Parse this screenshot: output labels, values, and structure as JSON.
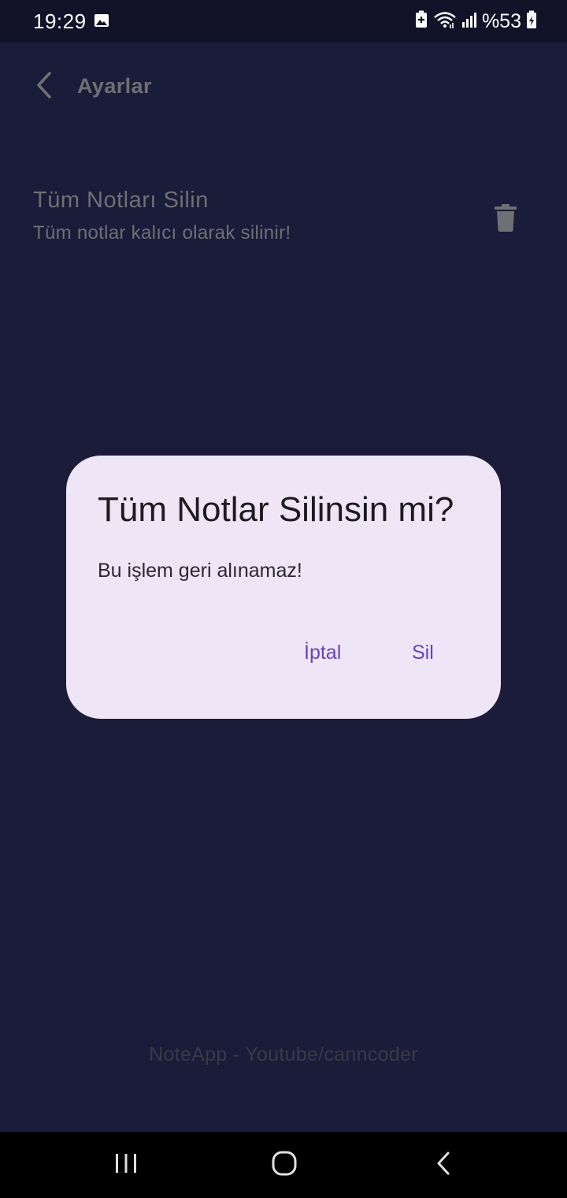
{
  "status_bar": {
    "time": "19:29",
    "battery_text": "%53",
    "icons": [
      "image-icon",
      "battery-saver-icon",
      "wifi-icon",
      "signal-icon",
      "battery-icon"
    ]
  },
  "header": {
    "title": "Ayarlar",
    "back_icon": "chevron-left-icon"
  },
  "settings": {
    "delete_all": {
      "title": "Tüm Notları Silin",
      "subtitle": "Tüm notlar kalıcı olarak silinir!",
      "icon": "trash-icon"
    }
  },
  "footer": {
    "credit": "NoteApp - Youtube/canncoder"
  },
  "dialog": {
    "title": "Tüm Notlar Silinsin mi?",
    "message": "Bu işlem geri alınamaz!",
    "cancel_label": "İptal",
    "confirm_label": "Sil"
  },
  "nav_bar": {
    "icons": [
      "recents-icon",
      "home-icon",
      "back-icon"
    ]
  },
  "colors": {
    "background": "#1b1b3a",
    "status_bar": "#121229",
    "dialog_surface": "#eee5f7",
    "dialog_button": "#6a42b8",
    "muted_text": "#6f6f74"
  }
}
